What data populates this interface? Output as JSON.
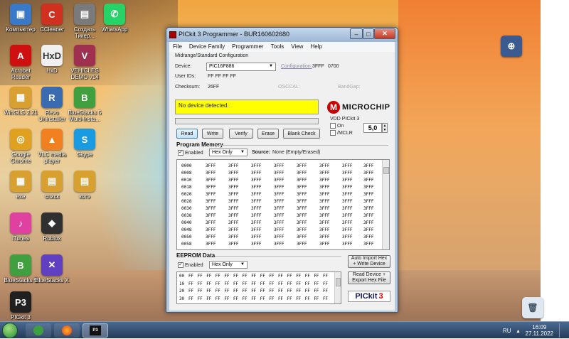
{
  "desktop": {
    "icons": [
      {
        "label": "Компьютер",
        "glyph": "▣",
        "color": "#3a78c8"
      },
      {
        "label": "CCleaner",
        "glyph": "C",
        "color": "#d03020"
      },
      {
        "label": "Создать Тикер...",
        "glyph": "▤",
        "color": "#7a7a7a"
      },
      {
        "label": "WhatsApp",
        "glyph": "✆",
        "color": "#25d366"
      },
      {
        "label": "Acrobat Reader",
        "glyph": "A",
        "color": "#d01010"
      },
      {
        "label": "HxD",
        "glyph": "HxD",
        "color": "#f0f0f0"
      },
      {
        "label": "VEHICLES DEMO v14",
        "glyph": "V",
        "color": "#a03050"
      },
      {
        "label": "WinGLS 2.21",
        "glyph": "▦",
        "color": "#d8a030"
      },
      {
        "label": "Revo Uninstaller",
        "glyph": "R",
        "color": "#3a6ab0"
      },
      {
        "label": "BlueStacks 5 Multi-Insta...",
        "glyph": "B",
        "color": "#40a040"
      },
      {
        "label": "Google Chrome",
        "glyph": "◎",
        "color": "#e0a020"
      },
      {
        "label": "VLC media player",
        "glyph": "▲",
        "color": "#f08020"
      },
      {
        "label": "Skype",
        "glyph": "S",
        "color": "#1a9ae0"
      },
      {
        "label": "exe",
        "glyph": "▦",
        "color": "#d8a030"
      },
      {
        "label": "списк",
        "glyph": "▤",
        "color": "#d8a030"
      },
      {
        "label": "котэ",
        "glyph": "▤",
        "color": "#d8a030"
      },
      {
        "label": "iTunes",
        "glyph": "♪",
        "color": "#e040a0"
      },
      {
        "label": "Roblox",
        "glyph": "◆",
        "color": "#303030"
      },
      {
        "label": "BlueStacks 5",
        "glyph": "B",
        "color": "#40a040"
      },
      {
        "label": "BlueStacks X",
        "glyph": "✕",
        "color": "#6040c0"
      },
      {
        "label": "PICkit 3",
        "glyph": "P3",
        "color": "#202020"
      }
    ],
    "recycle_bin": "recycle-bin"
  },
  "taskbar": {
    "lang": "RU",
    "time": "16:09",
    "date": "27.11.2022"
  },
  "window": {
    "title": "PICkit 3 Programmer - BUR160602680",
    "menu": [
      "File",
      "Device Family",
      "Programmer",
      "Tools",
      "View",
      "Help"
    ],
    "config_group_title": "Midrange/Standard Configuration",
    "device_label": "Device:",
    "device_value": "PIC16F886",
    "configuration_label": "Configuration:",
    "configuration_values": [
      "3FFF",
      "0700"
    ],
    "userids_label": "User IDs:",
    "userids_value": "FF FF FF FF",
    "checksum_label": "Checksum:",
    "checksum_value": "26FF",
    "osccal_label": "OSCCAL:",
    "bandgap_label": "BandGap:",
    "status_message": "No device detected.",
    "logo_text": "MICROCHIP",
    "vdd_label": "VDD PICkit 3",
    "vdd_on_label": "On",
    "vdd_mclr_label": "/MCLR",
    "vdd_value": "5,0",
    "buttons": {
      "read": "Read",
      "write": "Write",
      "verify": "Verify",
      "erase": "Erase",
      "blank_check": "Blank Check"
    },
    "program_memory": {
      "title": "Program Memory",
      "enabled_label": "Enabled",
      "mode": "Hex Only",
      "source_label": "Source:",
      "source_value": "None (Empty/Erased)",
      "rows": [
        {
          "addr": "0000",
          "cells": [
            "3FFF",
            "3FFF",
            "3FFF",
            "3FFF",
            "3FFF",
            "3FFF",
            "3FFF",
            "3FFF"
          ]
        },
        {
          "addr": "0008",
          "cells": [
            "3FFF",
            "3FFF",
            "3FFF",
            "3FFF",
            "3FFF",
            "3FFF",
            "3FFF",
            "3FFF"
          ]
        },
        {
          "addr": "0010",
          "cells": [
            "3FFF",
            "3FFF",
            "3FFF",
            "3FFF",
            "3FFF",
            "3FFF",
            "3FFF",
            "3FFF"
          ]
        },
        {
          "addr": "0018",
          "cells": [
            "3FFF",
            "3FFF",
            "3FFF",
            "3FFF",
            "3FFF",
            "3FFF",
            "3FFF",
            "3FFF"
          ]
        },
        {
          "addr": "0020",
          "cells": [
            "3FFF",
            "3FFF",
            "3FFF",
            "3FFF",
            "3FFF",
            "3FFF",
            "3FFF",
            "3FFF"
          ]
        },
        {
          "addr": "0028",
          "cells": [
            "3FFF",
            "3FFF",
            "3FFF",
            "3FFF",
            "3FFF",
            "3FFF",
            "3FFF",
            "3FFF"
          ]
        },
        {
          "addr": "0030",
          "cells": [
            "3FFF",
            "3FFF",
            "3FFF",
            "3FFF",
            "3FFF",
            "3FFF",
            "3FFF",
            "3FFF"
          ]
        },
        {
          "addr": "0038",
          "cells": [
            "3FFF",
            "3FFF",
            "3FFF",
            "3FFF",
            "3FFF",
            "3FFF",
            "3FFF",
            "3FFF"
          ]
        },
        {
          "addr": "0040",
          "cells": [
            "3FFF",
            "3FFF",
            "3FFF",
            "3FFF",
            "3FFF",
            "3FFF",
            "3FFF",
            "3FFF"
          ]
        },
        {
          "addr": "0048",
          "cells": [
            "3FFF",
            "3FFF",
            "3FFF",
            "3FFF",
            "3FFF",
            "3FFF",
            "3FFF",
            "3FFF"
          ]
        },
        {
          "addr": "0050",
          "cells": [
            "3FFF",
            "3FFF",
            "3FFF",
            "3FFF",
            "3FFF",
            "3FFF",
            "3FFF",
            "3FFF"
          ]
        },
        {
          "addr": "0058",
          "cells": [
            "3FFF",
            "3FFF",
            "3FFF",
            "3FFF",
            "3FFF",
            "3FFF",
            "3FFF",
            "3FFF"
          ]
        }
      ]
    },
    "eeprom": {
      "title": "EEPROM Data",
      "enabled_label": "Enabled",
      "mode": "Hex Only",
      "rows": [
        {
          "addr": "00",
          "cells": [
            "FF",
            "FF",
            "FF",
            "FF",
            "FF",
            "FF",
            "FF",
            "FF",
            "FF",
            "FF",
            "FF",
            "FF",
            "FF",
            "FF",
            "FF",
            "FF"
          ]
        },
        {
          "addr": "10",
          "cells": [
            "FF",
            "FF",
            "FF",
            "FF",
            "FF",
            "FF",
            "FF",
            "FF",
            "FF",
            "FF",
            "FF",
            "FF",
            "FF",
            "FF",
            "FF",
            "FF"
          ]
        },
        {
          "addr": "20",
          "cells": [
            "FF",
            "FF",
            "FF",
            "FF",
            "FF",
            "FF",
            "FF",
            "FF",
            "FF",
            "FF",
            "FF",
            "FF",
            "FF",
            "FF",
            "FF",
            "FF"
          ]
        },
        {
          "addr": "30",
          "cells": [
            "FF",
            "FF",
            "FF",
            "FF",
            "FF",
            "FF",
            "FF",
            "FF",
            "FF",
            "FF",
            "FF",
            "FF",
            "FF",
            "FF",
            "FF",
            "FF"
          ]
        }
      ]
    },
    "auto_import_label_1": "Auto Import Hex",
    "auto_import_label_2": "+ Write Device",
    "read_export_label_1": "Read Device +",
    "read_export_label_2": "Export Hex File",
    "pickit_logo": "PICkit",
    "pickit_logo_num": "3"
  }
}
